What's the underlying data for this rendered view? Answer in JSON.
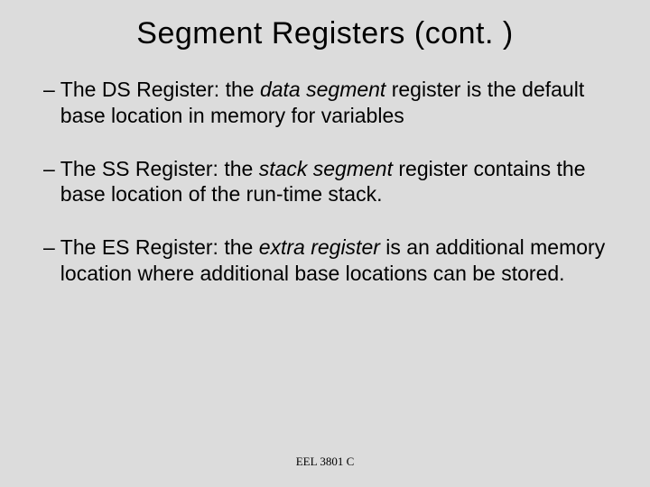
{
  "title": "Segment Registers (cont. )",
  "bullets": [
    {
      "pre": "The DS Register: the ",
      "italic": "data segment",
      "post": " register is the default base location in memory for variables"
    },
    {
      "pre": "The SS Register: the ",
      "italic": "stack segment",
      "post": " register contains the base location of the run-time stack."
    },
    {
      "pre": "The ES Register: the ",
      "italic": "extra register",
      "post": " is an additional memory location where additional base locations can be stored."
    }
  ],
  "footer": "EEL 3801 C"
}
